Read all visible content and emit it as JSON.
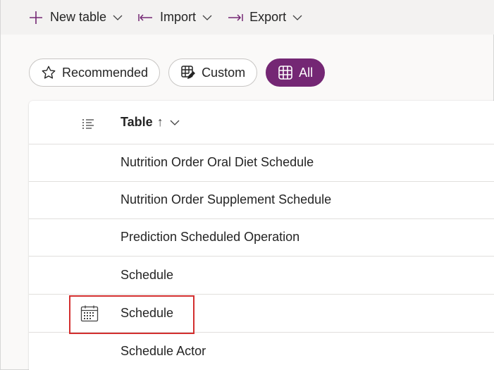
{
  "toolbar": {
    "new_table": "New table",
    "import": "Import",
    "export": "Export"
  },
  "filters": {
    "recommended": "Recommended",
    "custom": "Custom",
    "all": "All",
    "active": "all"
  },
  "table": {
    "column_header": "Table",
    "sort_indicator": "↑",
    "rows": [
      {
        "name": "Nutrition Order Oral Diet Schedule",
        "icon": ""
      },
      {
        "name": "Nutrition Order Supplement Schedule",
        "icon": ""
      },
      {
        "name": "Prediction Scheduled Operation",
        "icon": ""
      },
      {
        "name": "Schedule",
        "icon": ""
      },
      {
        "name": "Schedule",
        "icon": "calendar-icon"
      },
      {
        "name": "Schedule Actor",
        "icon": ""
      }
    ]
  },
  "colors": {
    "accent": "#742774",
    "highlight": "#d32f2f"
  }
}
